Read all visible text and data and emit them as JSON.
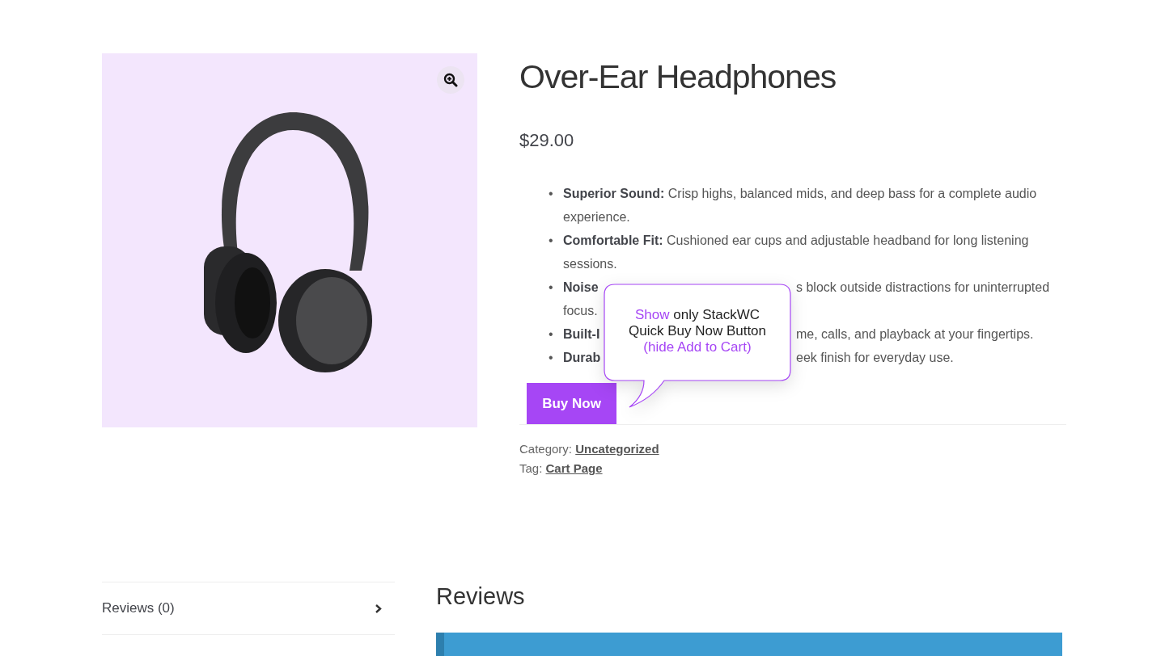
{
  "product": {
    "title": "Over-Ear Headphones",
    "price": "$29.00",
    "features": [
      {
        "kind": "full",
        "marker": "•",
        "label": "Superior Sound:",
        "text": "Crisp highs, balanced mids, and deep bass for a complete audio experience."
      },
      {
        "kind": "full",
        "marker": "•",
        "label": "Comfortable Fit:",
        "text": "Cushioned ear cups and adjustable headband for long listening sessions."
      },
      {
        "kind": "partial",
        "marker": "•",
        "label": "Noise",
        "text": "s block outside distractions for uninterrupted",
        "next_line": "focus."
      },
      {
        "kind": "partial",
        "marker": "•",
        "label": "Built-I",
        "text": "me, calls, and playback at your fingertips."
      },
      {
        "kind": "partial",
        "marker": "•",
        "label": "Durab",
        "text": "eek finish for everyday use."
      }
    ],
    "buy_button": "Buy Now",
    "meta": [
      {
        "label": "Category:",
        "link": "Uncategorized"
      },
      {
        "label": "Tag:",
        "link": "Cart Page"
      }
    ]
  },
  "tooltip": {
    "lines": [
      [
        {
          "text": "Show",
          "highlight": true
        },
        {
          "text": "only StackWC",
          "highlight": false
        }
      ],
      [
        {
          "text": "Quick Buy Now Button",
          "highlight": false
        }
      ],
      [
        {
          "text": "(hide Add to Cart)",
          "highlight": true
        }
      ]
    ]
  },
  "tabs": [
    {
      "label": "Reviews (0)",
      "selected": true
    }
  ],
  "reviews": {
    "heading": "Reviews"
  }
}
